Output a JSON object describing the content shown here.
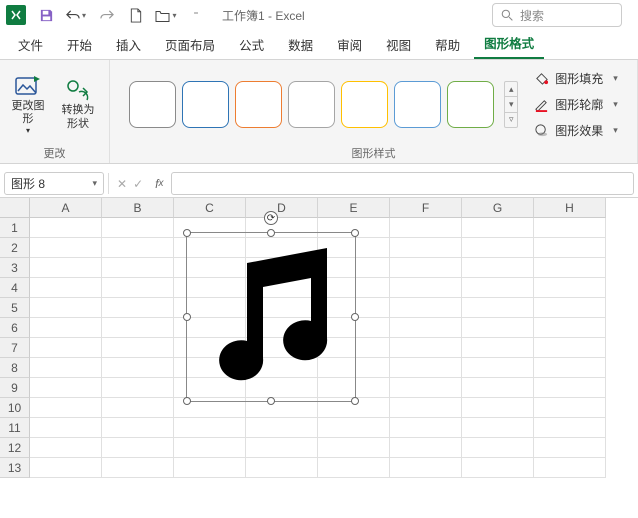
{
  "app": {
    "title": "工作簿1 - Excel",
    "search_placeholder": "搜索"
  },
  "tabs": {
    "file": "文件",
    "home": "开始",
    "insert": "插入",
    "layout": "页面布局",
    "formulas": "公式",
    "data": "数据",
    "review": "审阅",
    "view": "视图",
    "help": "帮助",
    "shape_format": "图形格式"
  },
  "ribbon": {
    "change_group": {
      "label": "更改",
      "change_graphic": "更改图形",
      "convert_shape": "转换为形状"
    },
    "styles_group": {
      "label": "图形样式",
      "styles": [
        {
          "border": "#8a8a8a"
        },
        {
          "border": "#2e74b5"
        },
        {
          "border": "#ed7d31"
        },
        {
          "border": "#a5a5a5"
        },
        {
          "border": "#ffc000"
        },
        {
          "border": "#5b9bd5"
        },
        {
          "border": "#70ad47"
        }
      ],
      "fill": "图形填充",
      "outline": "图形轮廓",
      "effects": "图形效果"
    }
  },
  "namebox": {
    "value": "图形 8"
  },
  "grid": {
    "columns": [
      "A",
      "B",
      "C",
      "D",
      "E",
      "F",
      "G",
      "H"
    ],
    "rows": [
      "1",
      "2",
      "3",
      "4",
      "5",
      "6",
      "7",
      "8",
      "9",
      "10",
      "11",
      "12",
      "13"
    ]
  },
  "shape": {
    "name": "music-note-icon"
  }
}
